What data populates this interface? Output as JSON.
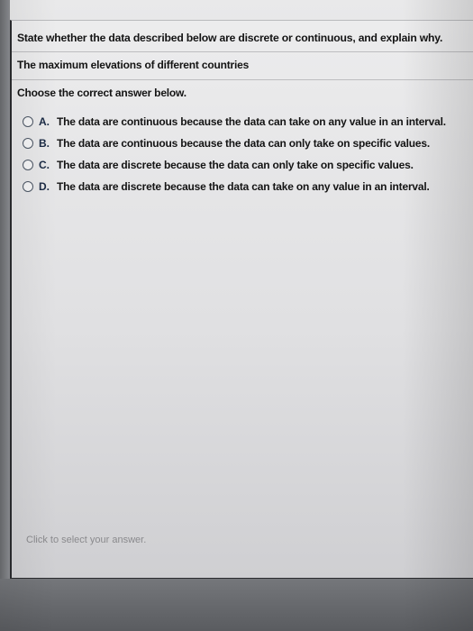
{
  "question": {
    "instruction": "State whether the data described below are discrete or continuous, and explain why.",
    "subject": "The maximum elevations of different countries",
    "prompt": "Choose the correct answer below."
  },
  "choices": [
    {
      "letter": "A.",
      "text": "The data are continuous because the data can take on any value in an interval."
    },
    {
      "letter": "B.",
      "text": "The data are continuous because the data can only take on specific values."
    },
    {
      "letter": "C.",
      "text": "The data are discrete because the data can only take on specific values."
    },
    {
      "letter": "D.",
      "text": "The data are discrete because the data can take on any value in an interval."
    }
  ],
  "footer": {
    "hint": "Click to select your answer."
  },
  "colors": {
    "text": "#141414",
    "hint": "#8a8a8d",
    "radio_border": "#4c5664"
  }
}
